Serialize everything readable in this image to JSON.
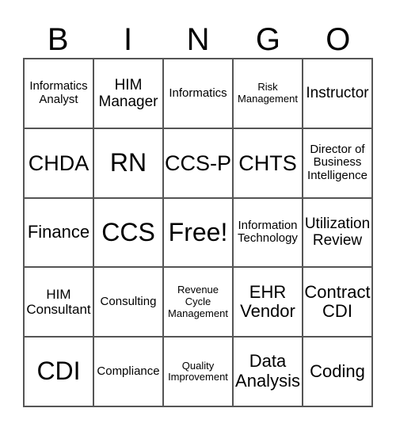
{
  "header": [
    "B",
    "I",
    "N",
    "G",
    "O"
  ],
  "cells": [
    "Informatics Analyst",
    "HIM Manager",
    "Informatics",
    "Risk Management",
    "Instructor",
    "CHDA",
    "RN",
    "CCS-P",
    "CHTS",
    "Director of Business Intelligence",
    "Finance",
    "CCS",
    "Free!",
    "Information Technology",
    "Utilization Review",
    "HIM Consultant",
    "Consulting",
    "Revenue Cycle Management",
    "EHR Vendor",
    "Contract CDI",
    "CDI",
    "Compliance",
    "Quality Improvement",
    "Data Analysis",
    "Coding"
  ]
}
